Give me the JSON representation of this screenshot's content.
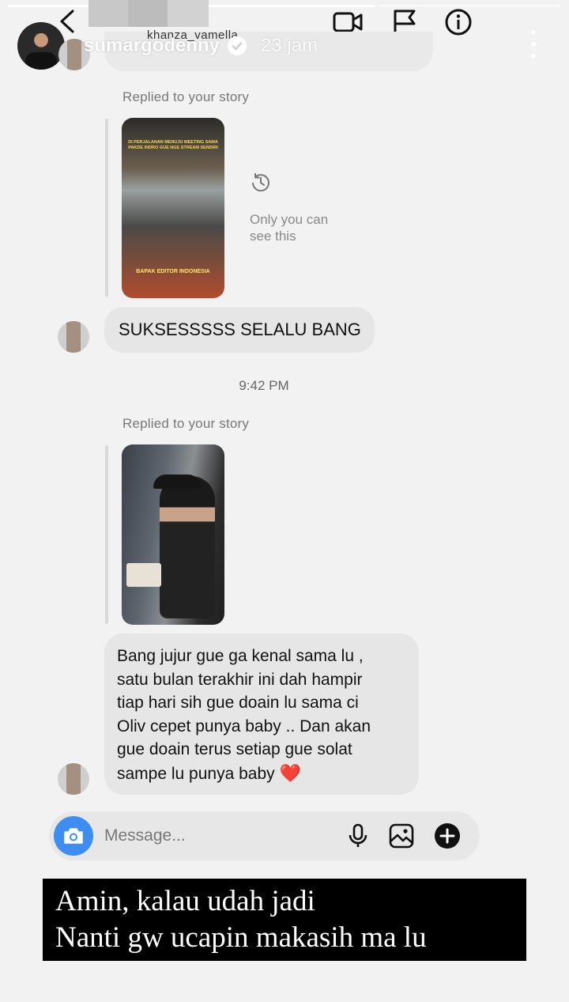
{
  "story": {
    "username": "sumargodenny",
    "time": "23 jam",
    "verified": true,
    "progress_segments": 3
  },
  "chat": {
    "partial_username": "khanza_vamella",
    "messages": [
      {
        "type": "story-reply",
        "label": "Replied to your story",
        "story_caption_top": "DI PERJALANAN MENUJU MEETING SAMA PAKDE INDRO GUE NGE STREAM SENDIRI",
        "story_caption_bottom": "BAPAK EDITOR INDONESIA",
        "expired_note": "Only you can see this"
      },
      {
        "type": "text",
        "text": "SUKSESSSSS SELALU BANG"
      },
      {
        "type": "timestamp",
        "text": "9:42 PM"
      },
      {
        "type": "story-reply",
        "label": "Replied to your story"
      },
      {
        "type": "text",
        "lines": [
          "Bang jujur gue ga kenal sama lu ,",
          "satu bulan terakhir ini dah hampir",
          "tiap hari sih gue doain lu sama ci",
          "Oliv cepet punya baby .. Dan akan",
          "gue doain terus setiap gue solat",
          "sampe lu punya baby"
        ],
        "emoji": "❤️"
      }
    ]
  },
  "composer": {
    "placeholder": "Message..."
  },
  "caption": {
    "line1": "Amin, kalau udah jadi",
    "line2": "Nanti gw ucapin makasih ma lu"
  },
  "colors": {
    "accent": "#3d8ef0",
    "bubble": "#e6e6e6",
    "background": "#f2f2f2",
    "heart": "#dd1111"
  },
  "icons": {
    "back": "chevron-left-icon",
    "video": "video-camera-icon",
    "flag": "flag-icon",
    "info": "info-icon",
    "expired": "history-icon",
    "camera": "camera-icon",
    "mic": "microphone-icon",
    "gallery": "image-icon",
    "add": "plus-circle-icon",
    "more": "more-vertical-icon"
  }
}
